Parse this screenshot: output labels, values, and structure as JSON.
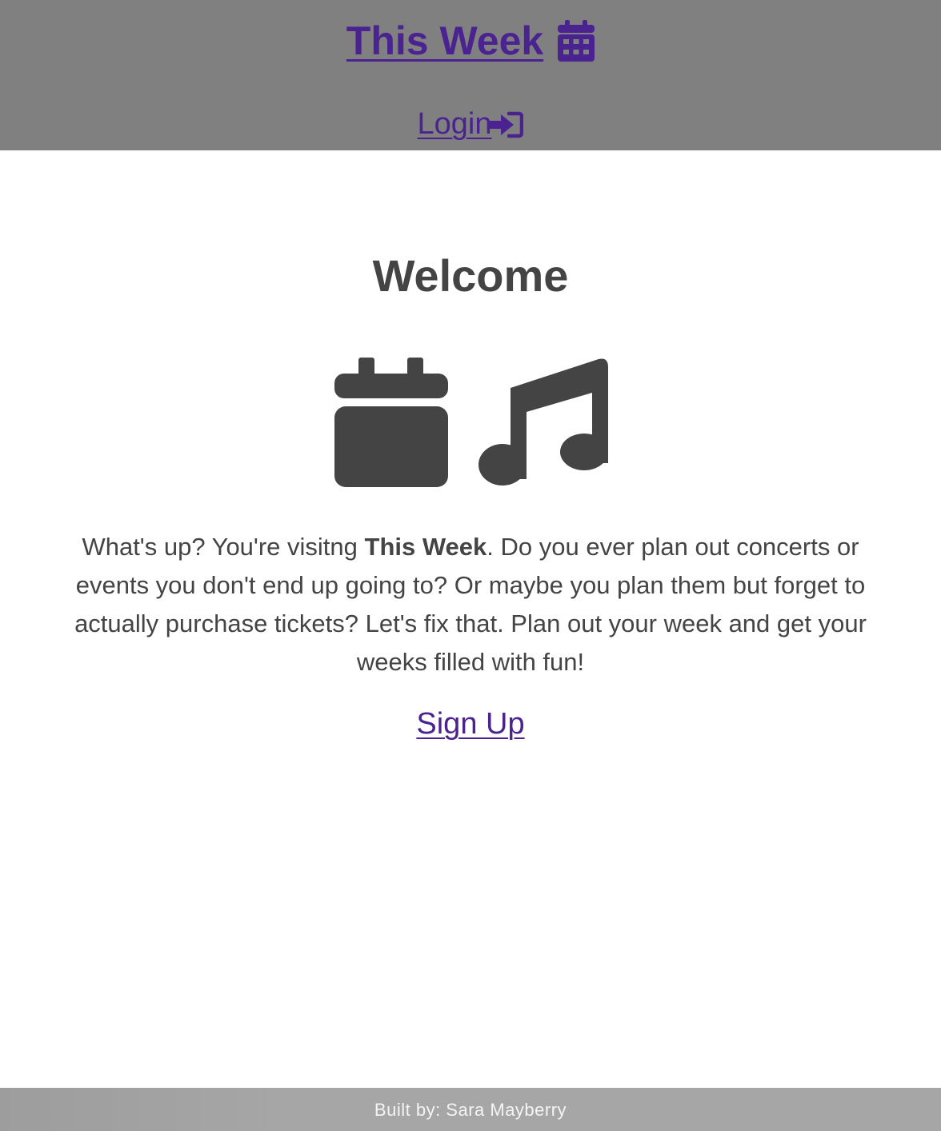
{
  "header": {
    "brand": "This Week",
    "brand_icon": "calendar-icon",
    "login_label": "Login",
    "login_icon": "sign-in-icon"
  },
  "main": {
    "title": "Welcome",
    "hero_icons": [
      "calendar-icon",
      "music-note-icon"
    ],
    "intro_before": "What's up? You're visitng ",
    "intro_bold": "This Week",
    "intro_after": ". Do you ever plan out concerts or events you don't end up going to? Or maybe you plan them but forget to actually purchase tickets? Let's fix that. Plan out your week and get your weeks filled with fun!",
    "signup_label": "Sign Up"
  },
  "footer": {
    "credit": "Built by: Sara Mayberry"
  },
  "colors": {
    "header_bg": "#808080",
    "link": "#4a2391",
    "text": "#444444",
    "footer_bg": "#a6a6a6"
  }
}
